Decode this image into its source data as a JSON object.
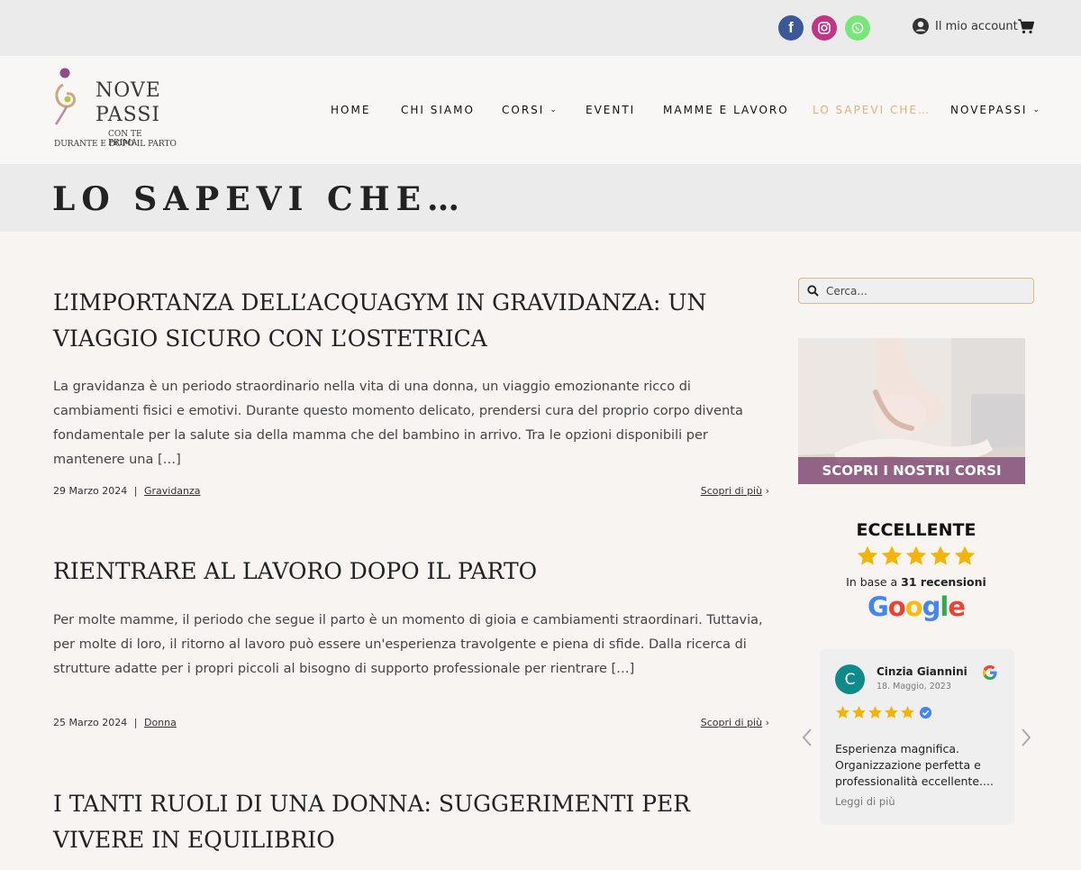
{
  "topbar": {
    "social": [
      {
        "name": "facebook",
        "glyph": "f"
      },
      {
        "name": "instagram"
      },
      {
        "name": "whatsapp"
      }
    ],
    "account_label": "Il mio account"
  },
  "logo": {
    "line1": "NOVE",
    "line2": "PASSI",
    "line3": "CON TE PRIMA",
    "line4": "DURANTE E DOPO IL PARTO"
  },
  "nav": {
    "items": [
      {
        "label": "HOME"
      },
      {
        "label": "CHI SIAMO"
      },
      {
        "label": "CORSI",
        "dropdown": true
      },
      {
        "label": "EVENTI"
      },
      {
        "label": "MAMME E LAVORO"
      },
      {
        "label": "LO SAPEVI CHE…",
        "active": true
      },
      {
        "label": "NOVEPASSI",
        "dropdown": true
      }
    ],
    "active_color": "#e0b07a"
  },
  "page": {
    "title": "LO SAPEVI CHE…"
  },
  "posts": [
    {
      "title": "L’IMPORTANZA DELL’ACQUAGYM IN GRAVIDANZA: UN VIAGGIO SICURO CON L’OSTETRICA",
      "excerpt": "La gravidanza è un periodo straordinario nella vita di una donna, un viaggio emozionante ricco di cambiamenti fisici e emotivi. Durante questo momento delicato, prendersi cura del proprio corpo diventa fondamentale per la salute sia della mamma che del bambino in arrivo. Tra le opzioni disponibili per mantenere una […]",
      "date": "29 Marzo 2024",
      "separator": "|",
      "category": "Gravidanza",
      "read_more": "Scopri di più"
    },
    {
      "title": "RIENTRARE AL LAVORO DOPO IL PARTO",
      "excerpt": "Per molte mamme, il periodo che segue il parto è un momento di gioia e cambiamenti straordinari. Tuttavia, per molte di loro, il ritorno al lavoro può essere un'esperienza travolgente e piena di sfide. Dalla ricerca di strutture adatte per i propri piccoli al bisogno di supporto professionale per rientrare […]",
      "date": "25 Marzo 2024",
      "separator": "|",
      "category": "Donna",
      "read_more": "Scopri di più"
    },
    {
      "title": "I TANTI RUOLI DI UNA DONNA: SUGGERIMENTI PER VIVERE IN EQUILIBRIO"
    }
  ],
  "sidebar": {
    "search_placeholder": "Cerca...",
    "promo_label": "SCOPRI I NOSTRI CORSI",
    "rating": {
      "title": "ECCELLENTE",
      "stars": 5,
      "based_on_prefix": "In base a",
      "review_count": "31 recensioni",
      "brand": "Google"
    },
    "review": {
      "avatar_letter": "C",
      "author": "Cinzia Giannini",
      "date": "18. Maggio, 2023",
      "stars": 5,
      "text": "Esperienza magnifica. Organizzazione perfetta e professionalità eccellente....",
      "more": "Leggi di più"
    }
  },
  "colors": {
    "facebook": "#3b5998",
    "instagram": "#c13584",
    "whatsapp": "#77e878",
    "star": "#f5b400",
    "accent": "#e0b07a"
  }
}
